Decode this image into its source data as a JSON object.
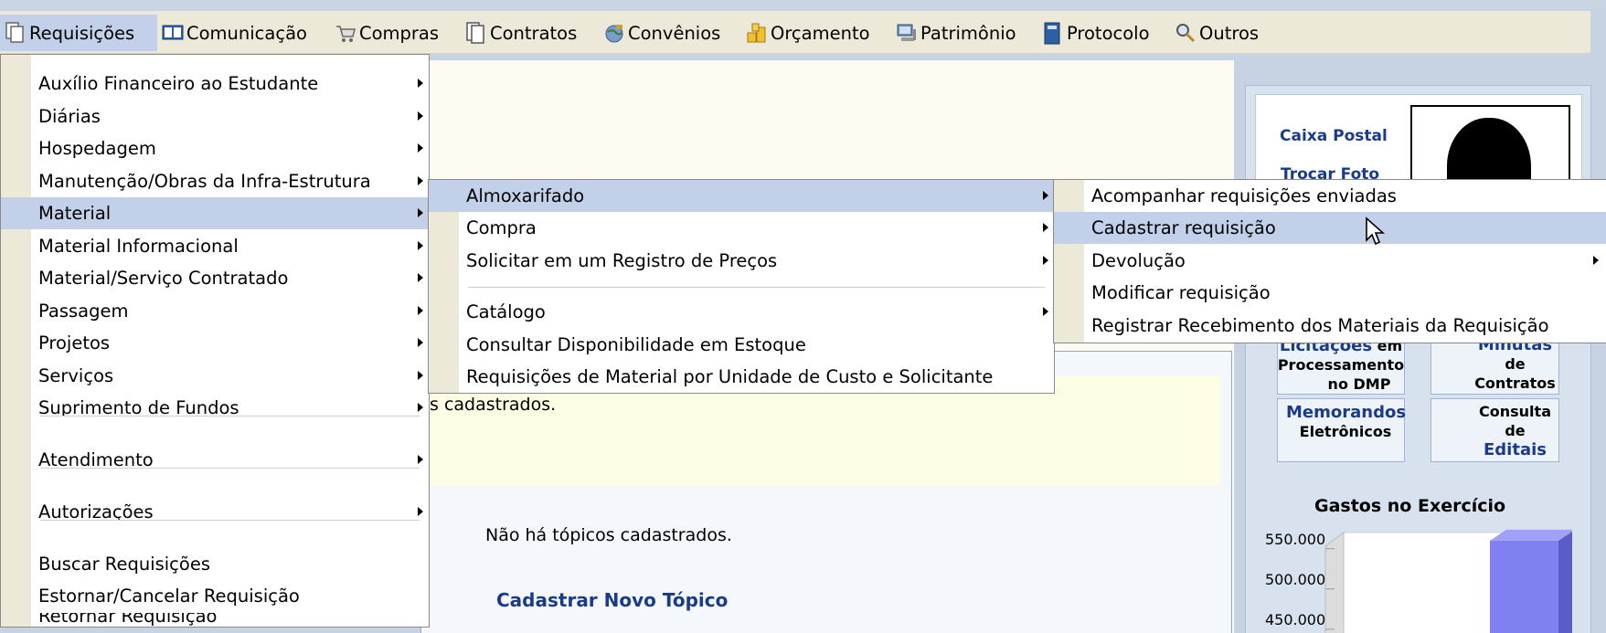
{
  "menubar": {
    "items": [
      {
        "label": "Requisições",
        "icon": "document-copy-icon"
      },
      {
        "label": "Comunicação",
        "icon": "book-icon"
      },
      {
        "label": "Compras",
        "icon": "shopping-cart-icon"
      },
      {
        "label": "Contratos",
        "icon": "contract-pages-icon"
      },
      {
        "label": "Convênios",
        "icon": "globe-icon"
      },
      {
        "label": "Orçamento",
        "icon": "coins-icon"
      },
      {
        "label": "Patrimônio",
        "icon": "computer-icon"
      },
      {
        "label": "Protocolo",
        "icon": "notebook-icon"
      },
      {
        "label": "Outros",
        "icon": "magnifier-icon"
      }
    ]
  },
  "menu1": {
    "items": [
      "Auxílio Financeiro ao Estudante",
      "Diárias",
      "Hospedagem",
      "Manutenção/Obras da Infra-Estrutura",
      "Material",
      "Material Informacional",
      "Material/Serviço Contratado",
      "Passagem",
      "Projetos",
      "Serviços",
      "Suprimento de Fundos",
      "Atendimento",
      "Autorizações",
      "Buscar Requisições",
      "Estornar/Cancelar Requisição",
      "Retornar Requisição"
    ]
  },
  "menu2": {
    "items": [
      "Almoxarifado",
      "Compra",
      "Solicitar em um Registro de Preços",
      "Catálogo",
      "Consultar Disponibilidade em Estoque",
      "Requisições de Material por Unidade de Custo e Solicitante"
    ]
  },
  "menu3": {
    "items": [
      "Acompanhar requisições enviadas",
      "Cadastrar requisição",
      "Devolução",
      "Modificar requisição",
      "Registrar Recebimento dos Materiais da Requisição"
    ]
  },
  "content": {
    "notice_text": "s cadastrados.",
    "no_topics": "Não há tópicos cadastrados.",
    "new_topic_link": "Cadastrar Novo Tópico"
  },
  "sidebar": {
    "caixa_postal": "Caixa Postal",
    "trocar_foto": "Trocar Foto",
    "quick": {
      "licitacoes": [
        "Licitações",
        "em",
        "Processamento",
        "no DMP"
      ],
      "minutas": [
        "Minutas",
        "de",
        "Contratos"
      ],
      "memorandos": [
        "Memorandos",
        "Eletrônicos"
      ],
      "editais": [
        "Consulta",
        "de",
        "Editais"
      ]
    },
    "chart_title": "Gastos no Exercício"
  },
  "chart_data": {
    "type": "bar",
    "title": "Gastos no Exercício",
    "tick_labels": [
      "550.000",
      "500.000",
      "450.000"
    ],
    "ylim": [
      400000,
      570000
    ],
    "values": [
      560000
    ]
  },
  "colors": {
    "menu_highlight": "#c3d0ea",
    "menubar_bg": "#ece9d8",
    "link_blue": "#1a3b8a",
    "bar_color": "#8080f0"
  }
}
